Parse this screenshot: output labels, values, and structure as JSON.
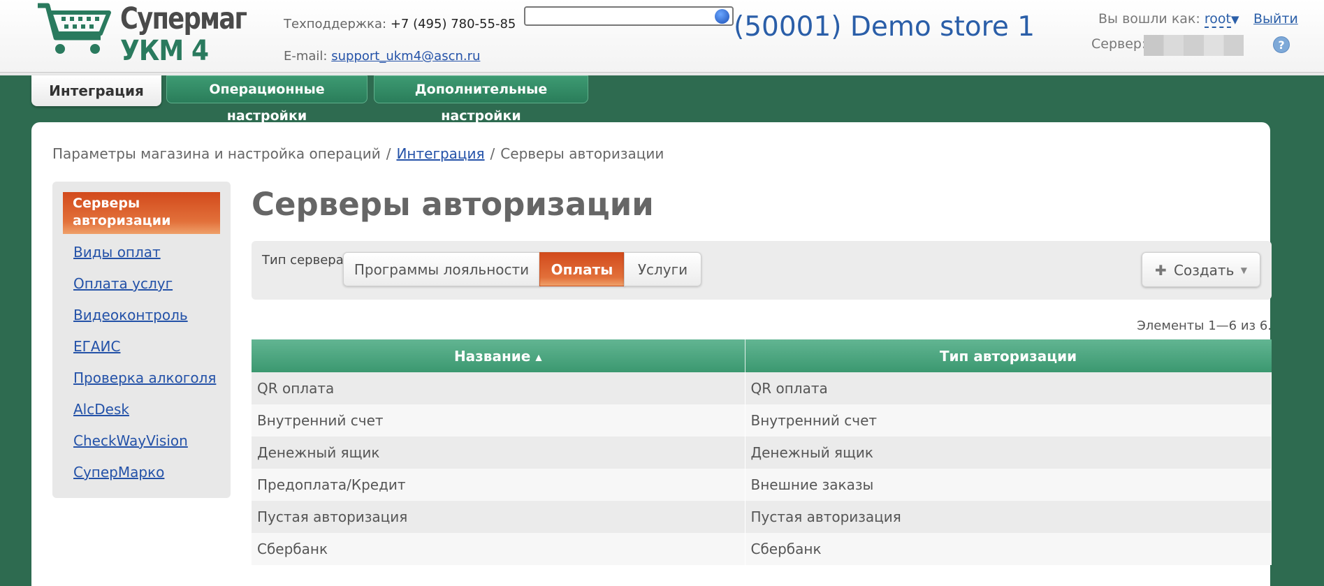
{
  "header": {
    "logo_title": "Супермаг",
    "logo_sub": "УКМ 4",
    "support_label": "Техподдержка:",
    "support_phone": "+7 (495) 780-55-85",
    "email_label": "E-mail:",
    "email": "support_ukm4@ascn.ru",
    "search_value": "",
    "store_name": "(50001) Demo store 1",
    "login_label": "Вы вошли как:",
    "user": "root",
    "logout": "Выйти",
    "server_label": "Сервер:",
    "help": "?"
  },
  "top_tabs": [
    {
      "label": "Интеграция",
      "active": true
    },
    {
      "label": "Операционные настройки",
      "active": false
    },
    {
      "label": "Дополнительные настройки",
      "active": false
    }
  ],
  "breadcrumb": {
    "root": "Параметры магазина и настройка операций",
    "link": "Интеграция",
    "current": "Серверы авторизации",
    "separator": "/"
  },
  "sidebar": {
    "active": "Серверы авторизации",
    "items": [
      "Виды оплат",
      "Оплата услуг",
      "Видеоконтроль",
      "ЕГАИС",
      "Проверка алкоголя",
      "AlcDesk",
      "CheckWayVision",
      "СуперМарко"
    ]
  },
  "main": {
    "title": "Серверы авторизации",
    "filter_label": "Тип сервера:",
    "server_types": [
      "Программы лояльности",
      "Оплаты",
      "Услуги"
    ],
    "selected_type": "Оплаты",
    "create_label": "Создать",
    "items_count": "Элементы 1—6 из 6."
  },
  "table": {
    "columns": [
      "Название",
      "Тип авторизации"
    ],
    "rows": [
      [
        "QR оплата",
        "QR оплата"
      ],
      [
        "Внутренний счет",
        "Внутренний счет"
      ],
      [
        "Денежный ящик",
        "Денежный ящик"
      ],
      [
        "Предоплата/Кредит",
        "Внешние заказы"
      ],
      [
        "Пустая авторизация",
        "Пустая авторизация"
      ],
      [
        "Сбербанк",
        "Сбербанк"
      ]
    ]
  },
  "colors": {
    "brand_green": "#2e6b50",
    "accent_orange": "#d24a1c",
    "link_blue": "#2452a8"
  }
}
